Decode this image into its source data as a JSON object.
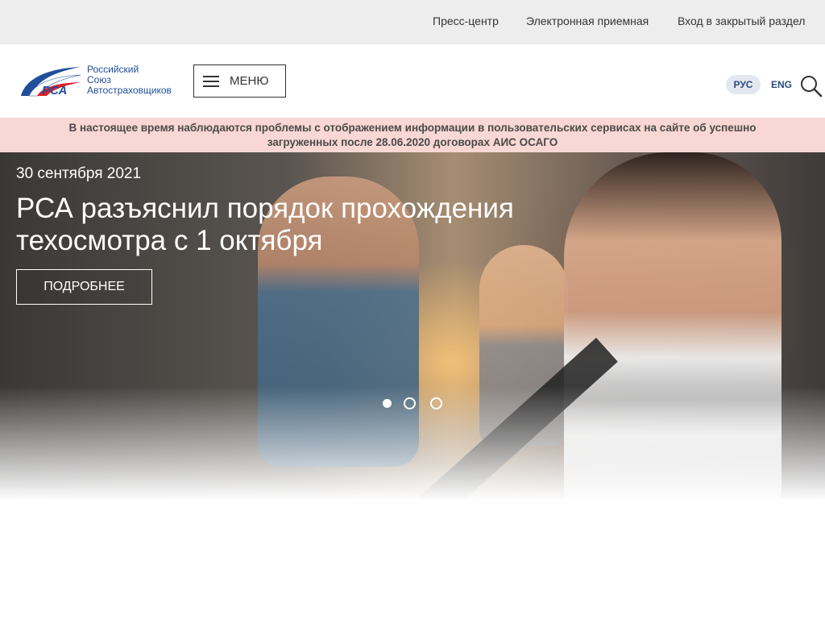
{
  "topbar": {
    "links": [
      "Пресс-центр",
      "Электронная приемная",
      "Вход в закрытый раздел"
    ]
  },
  "header": {
    "logo": {
      "mark": "РСА",
      "lines": [
        "Российский",
        "Союз",
        "Автостраховщиков"
      ]
    },
    "menu_label": "МЕНЮ",
    "lang_ru": "РУС",
    "lang_en": "ENG",
    "search_icon": "search-icon"
  },
  "alert": {
    "line1": "В настоящее время наблюдаются проблемы с отображением информации в пользовательских сервисах на сайте об успешно",
    "line2": "загруженных после 28.06.2020 договорах АИС ОСАГО"
  },
  "hero": {
    "date": "30 сентября 2021",
    "title": "РСА разъяснил порядок прохождения техосмотра с 1 октября",
    "button": "ПОДРОБНЕЕ",
    "slides": 3,
    "active_slide": 1
  },
  "colors": {
    "brand_blue": "#1f4e9a",
    "brand_red": "#d8232a",
    "alert_bg": "#f8d7d4",
    "topbar_bg": "#ededed"
  }
}
